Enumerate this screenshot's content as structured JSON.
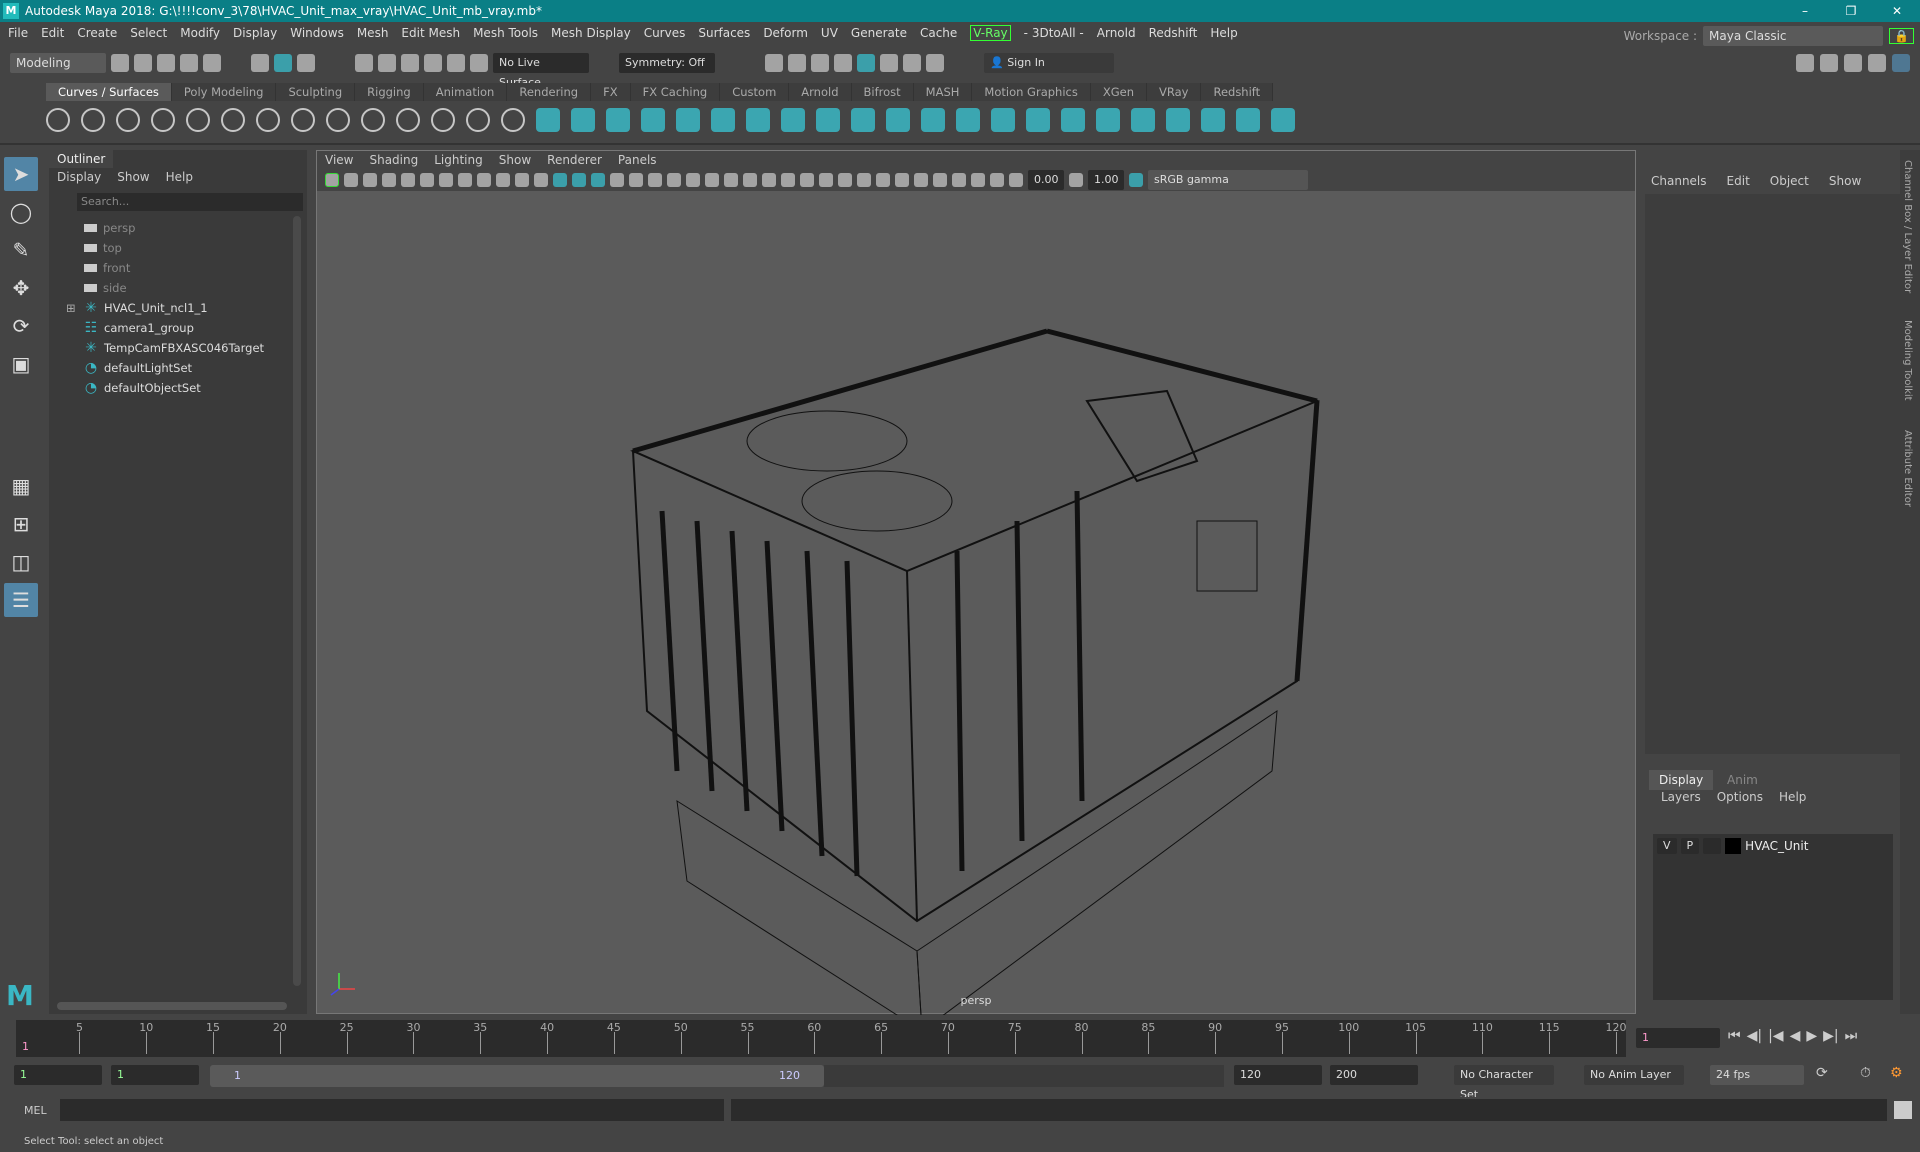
{
  "window": {
    "title": "Autodesk Maya 2018: G:\\!!!!conv_3\\78\\HVAC_Unit_max_vray\\HVAC_Unit_mb_vray.mb*",
    "logo": "M"
  },
  "menubar": [
    "File",
    "Edit",
    "Create",
    "Select",
    "Modify",
    "Display",
    "Windows",
    "Mesh",
    "Edit Mesh",
    "Mesh Tools",
    "Mesh Display",
    "Curves",
    "Surfaces",
    "Deform",
    "UV",
    "Generate",
    "Cache",
    "V-Ray",
    "- 3DtoAll -",
    "Arnold",
    "Redshift",
    "Help"
  ],
  "workspace": {
    "label": "Workspace :",
    "value": "Maya Classic"
  },
  "toolbar": {
    "mode": "Modeling",
    "live_surface": "No Live Surface",
    "symmetry": "Symmetry: Off",
    "sign_in": "Sign In"
  },
  "shelf": {
    "tabs": [
      "Curves / Surfaces",
      "Poly Modeling",
      "Sculpting",
      "Rigging",
      "Animation",
      "Rendering",
      "FX",
      "FX Caching",
      "Custom",
      "Arnold",
      "Bifrost",
      "MASH",
      "Motion Graphics",
      "XGen",
      "VRay",
      "Redshift"
    ],
    "active": 0
  },
  "outliner": {
    "title": "Outliner",
    "menu": [
      "Display",
      "Show",
      "Help"
    ],
    "search_placeholder": "Search...",
    "items": [
      {
        "label": "persp",
        "icon": "camera-icon"
      },
      {
        "label": "top",
        "icon": "camera-icon"
      },
      {
        "label": "front",
        "icon": "camera-icon"
      },
      {
        "label": "side",
        "icon": "camera-icon"
      },
      {
        "label": "HVAC_Unit_ncl1_1",
        "icon": "transform-icon",
        "expandable": true
      },
      {
        "label": "camera1_group",
        "icon": "group-icon"
      },
      {
        "label": "TempCamFBXASC046Target",
        "icon": "transform-icon"
      },
      {
        "label": "defaultLightSet",
        "icon": "set-icon"
      },
      {
        "label": "defaultObjectSet",
        "icon": "set-icon"
      }
    ]
  },
  "viewport": {
    "menu": [
      "View",
      "Shading",
      "Lighting",
      "Show",
      "Renderer",
      "Panels"
    ],
    "exposure": "0.00",
    "gamma": "1.00",
    "colorspace": "sRGB gamma",
    "camera_label": "persp"
  },
  "channelbox": {
    "menu": [
      "Channels",
      "Edit",
      "Object",
      "Show"
    ]
  },
  "layers": {
    "tabs": [
      "Display",
      "Anim"
    ],
    "menu": [
      "Layers",
      "Options",
      "Help"
    ],
    "layer": {
      "v": "V",
      "p": "P",
      "name": "HVAC_Unit",
      "color": "#000000"
    }
  },
  "side_tabs": [
    "Channel Box / Layer Editor",
    "Modeling Toolkit",
    "Attribute Editor"
  ],
  "timeline": {
    "ticks": [
      "5",
      "10",
      "15",
      "20",
      "25",
      "30",
      "35",
      "40",
      "45",
      "50",
      "55",
      "60",
      "65",
      "70",
      "75",
      "80",
      "85",
      "90",
      "95",
      "100",
      "105",
      "110",
      "115",
      "120"
    ],
    "start_marker": "1",
    "current_frame": "1"
  },
  "range": {
    "start": "1",
    "anim_start": "1",
    "range_start": "1",
    "range_end": "120",
    "end": "120",
    "anim_end": "200",
    "character_set": "No Character Set",
    "anim_layer": "No Anim Layer",
    "fps": "24 fps"
  },
  "mel": {
    "label": "MEL"
  },
  "status": "Select Tool: select an object",
  "colors": {
    "accent": "#3ab7c4",
    "titlebar": "#0a7f86",
    "selected": "#5285a6"
  }
}
